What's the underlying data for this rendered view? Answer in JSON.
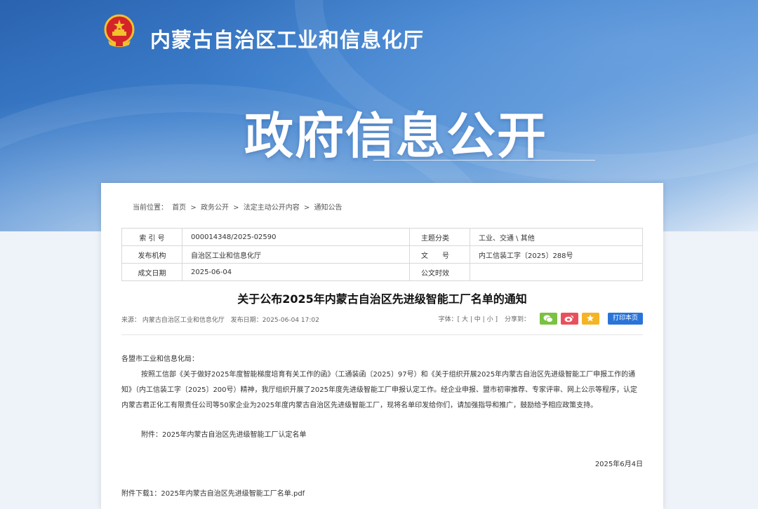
{
  "header": {
    "site_name": "内蒙古自治区工业和信息化厅",
    "banner_title": "政府信息公开",
    "emblem": "national-emblem-icon"
  },
  "breadcrumb": {
    "prefix": "当前位置：",
    "items": [
      "首页",
      "政务公开",
      "法定主动公开内容",
      "通知公告"
    ],
    "separator": ">"
  },
  "meta": {
    "index_label": "索 引 号",
    "index_value": "000014348/2025-02590",
    "topic_label": "主题分类",
    "topic_value": "工业、交通 \\ 其他",
    "publisher_label": "发布机构",
    "publisher_value": "自治区工业和信息化厅",
    "docno_label": "文　　号",
    "docno_value": "内工信装工字〔2025〕288号",
    "date_label": "成文日期",
    "date_value": "2025-06-04",
    "public_label": "公文时效",
    "public_value": ""
  },
  "article": {
    "title": "关于公布2025年内蒙古自治区先进级智能工厂名单的通知",
    "source": "来源：  内蒙古自治区工业和信息化厅",
    "published": "发布日期：2025-06-04 17:02",
    "font_label": "字体：[",
    "font_large": "大",
    "font_medium": "中",
    "font_small": "小",
    "font_end": "]",
    "share_label": "分享到：",
    "print_label": "打印本页",
    "salutation": "各盟市工业和信息化局：",
    "paragraph": "按照工信部《关于做好2025年度智能梯度培育有关工作的函》（工通装函〔2025〕97号）和《关于组织开展2025年内蒙古自治区先进级智能工厂申报工作的通知》（内工信装工字〔2025〕200号）精神，我厅组织开展了2025年度先进级智能工厂申报认定工作。经企业申报、盟市初审推荐、专家评审、网上公示等程序，认定内蒙古君正化工有限责任公司等50家企业为2025年度内蒙古自治区先进级智能工厂，现将名单印发给你们，请加强指导和推广，鼓励给予相应政策支持。",
    "attachment": "附件：2025年内蒙古自治区先进级智能工厂认定名单",
    "sign_date": "2025年6月4日",
    "download": "附件下载1：2025年内蒙古自治区先进级智能工厂名单.pdf"
  },
  "colors": {
    "banner_blue": "#3d7fcc",
    "wechat": "#7bc142",
    "weibo": "#e8515c",
    "favorite": "#f4b423",
    "print": "#2a74d9"
  }
}
